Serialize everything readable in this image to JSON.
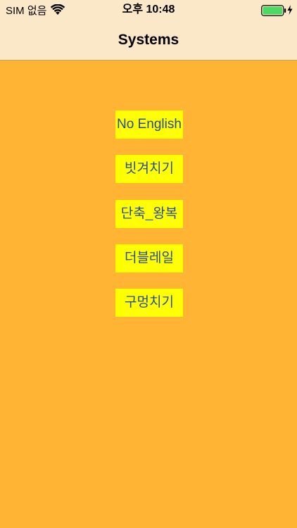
{
  "status_bar": {
    "carrier": "SIM 없음",
    "time": "오후 10:48",
    "wifi_icon": "wifi-icon",
    "battery_icon": "battery-icon",
    "charging_icon": "charging-bolt-icon",
    "battery_color": "#4CD964"
  },
  "nav": {
    "title": "Systems"
  },
  "menu": {
    "items": [
      {
        "label": "No English"
      },
      {
        "label": "빗겨치기"
      },
      {
        "label": "단축_왕복"
      },
      {
        "label": "더블레일"
      },
      {
        "label": "구멍치기"
      }
    ]
  },
  "colors": {
    "background": "#FFB433",
    "nav_background": "#FAE8C8",
    "button_background": "#FFFF00",
    "button_text": "#2A4A9A"
  }
}
